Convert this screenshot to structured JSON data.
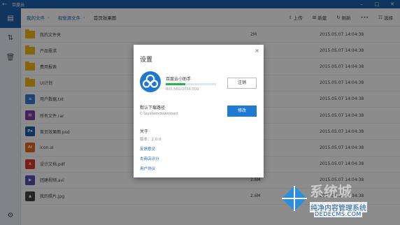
{
  "app": {
    "title": "百度云"
  },
  "breadcrumb": [
    "我的文件",
    "视觉源文件",
    "首页效果图"
  ],
  "actions": {
    "upload": "上传",
    "new": "新建",
    "refresh": "刷新",
    "more": "•••",
    "select": "选择"
  },
  "files": [
    {
      "name": "我的文件夹",
      "type": "folder",
      "size": "2M",
      "date": "2015.05.07  14:04:38"
    },
    {
      "name": "产品需求",
      "type": "folder",
      "size": "",
      "date": "2015.05.07  14:04:38"
    },
    {
      "name": "费用报表",
      "type": "folder",
      "size": "",
      "date": "2015.05.07  14:04:38"
    },
    {
      "name": "UI计划",
      "type": "folder",
      "size": "",
      "date": "2015.05.07  14:04:38"
    },
    {
      "name": "用户数据.txt",
      "type": "txt",
      "size": "",
      "date": "2015.05.07  14:04:38"
    },
    {
      "name": "所有文件.rar",
      "type": "rar",
      "size": "",
      "date": "2015.05.07  14:04:38"
    },
    {
      "name": "首页效果图.psd",
      "type": "psd",
      "size": "",
      "date": "2015.05.07  14:04:38"
    },
    {
      "name": "icon.ai",
      "type": "ai",
      "size": "",
      "date": "2015.05.07  14:04:38"
    },
    {
      "name": "设计文档.pdf",
      "type": "pdf",
      "size": "",
      "date": "2015.05.07  14:04:38"
    },
    {
      "name": "团建视频.avi",
      "type": "avi",
      "size": "2.6M",
      "date": "2015.05.07  14:04:38"
    },
    {
      "name": "我的照片.jpg",
      "type": "jpg",
      "size": "2.6M",
      "date": "2015.05.07  14:04:38"
    }
  ],
  "file_icon_glyphs": {
    "txt": "≡",
    "rar": "▤",
    "psd": "Ps",
    "ai": "Ai",
    "pdf": "⅄",
    "avi": "▶",
    "jpg": "▲"
  },
  "file_icon_colors": {
    "txt": "#3a7bd5",
    "rar": "#7b3fa8",
    "psd": "#1d5fb0",
    "ai": "#e8691c",
    "pdf": "#d9382b",
    "avi": "#5a4fb5",
    "jpg": "#444444"
  },
  "dialog": {
    "title": "设置",
    "close": "×",
    "account_name": "百度云小助手",
    "quota_text": "800.56G/2056.00G",
    "quota_fraction": 0.39,
    "logout": "注销",
    "download_label": "默认下载路径",
    "download_path": "C:\\systemdownload",
    "modify": "修改",
    "about_title": "关于",
    "version": "版本：2.0.0",
    "links": [
      "反馈意见",
      "去商店评分",
      "用户协议"
    ]
  },
  "watermark": {
    "big": "系统城",
    "line1": "纯净内容管理系统",
    "line2": "DEDECMS.COM"
  },
  "colors": {
    "accent": "#1e63b0",
    "folder": "#f3b814",
    "quota": "#2bb24c",
    "button_primary": "#1e7ad2"
  }
}
